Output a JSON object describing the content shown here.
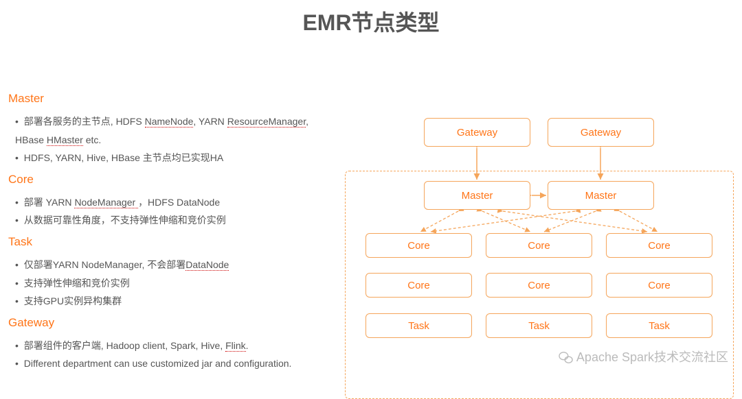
{
  "title": "EMR节点类型",
  "sections": [
    {
      "heading": "Master",
      "items": [
        "部署各服务的主节点, HDFS <u>NameNode</u>, YARN <u>ResourceManager</u>, HBase <u>HMaster</u> etc.",
        "HDFS, YARN, Hive, HBase 主节点均已实现HA"
      ]
    },
    {
      "heading": "Core",
      "items": [
        "部署 YARN <u>NodeManager </u>，HDFS DataNode",
        "从数据可靠性角度，不支持弹性伸缩和竞价实例"
      ]
    },
    {
      "heading": "Task",
      "items": [
        "仅部署YARN NodeManager, 不会部署<u>DataNode</u>",
        "支持弹性伸缩和竞价实例",
        "支持GPU实例异构集群"
      ]
    },
    {
      "heading": "Gateway",
      "items": [
        "部署组件的客户端, Hadoop client, Spark, Hive, <u>Flink</u>.",
        "Different department can use customized jar and configuration."
      ]
    }
  ],
  "diagram": {
    "nodes": {
      "gateway1": "Gateway",
      "gateway2": "Gateway",
      "master1": "Master",
      "master2": "Master",
      "core1": "Core",
      "core2": "Core",
      "core3": "Core",
      "core4": "Core",
      "core5": "Core",
      "core6": "Core",
      "task1": "Task",
      "task2": "Task",
      "task3": "Task"
    }
  },
  "watermark": "Apache Spark技术交流社区"
}
